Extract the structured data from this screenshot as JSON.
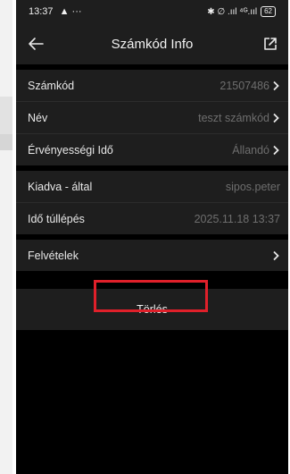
{
  "statusbar": {
    "time": "13:37",
    "left_icons": "▲ ···",
    "right_icons": "✱ ∅ .ııl ⁴ᴳ.ııl",
    "battery": "62"
  },
  "header": {
    "title": "Számkód Info"
  },
  "section1": [
    {
      "label": "Számkód",
      "value": "21507486"
    },
    {
      "label": "Név",
      "value": "teszt számkód"
    },
    {
      "label": "Érvényességi Idő",
      "value": "Állandó"
    }
  ],
  "section2": [
    {
      "label": "Kiadva - által",
      "value": "sipos.peter"
    },
    {
      "label": "Idő túllépés",
      "value": "2025.11.18 13:37"
    }
  ],
  "section3": [
    {
      "label": "Felvételek",
      "value": ""
    }
  ],
  "actions": {
    "delete_label": "Törlés"
  },
  "colors": {
    "background": "#000000",
    "panel": "#1e1e1e",
    "highlight": "#e0202a",
    "value_text": "#6e6e6e"
  }
}
